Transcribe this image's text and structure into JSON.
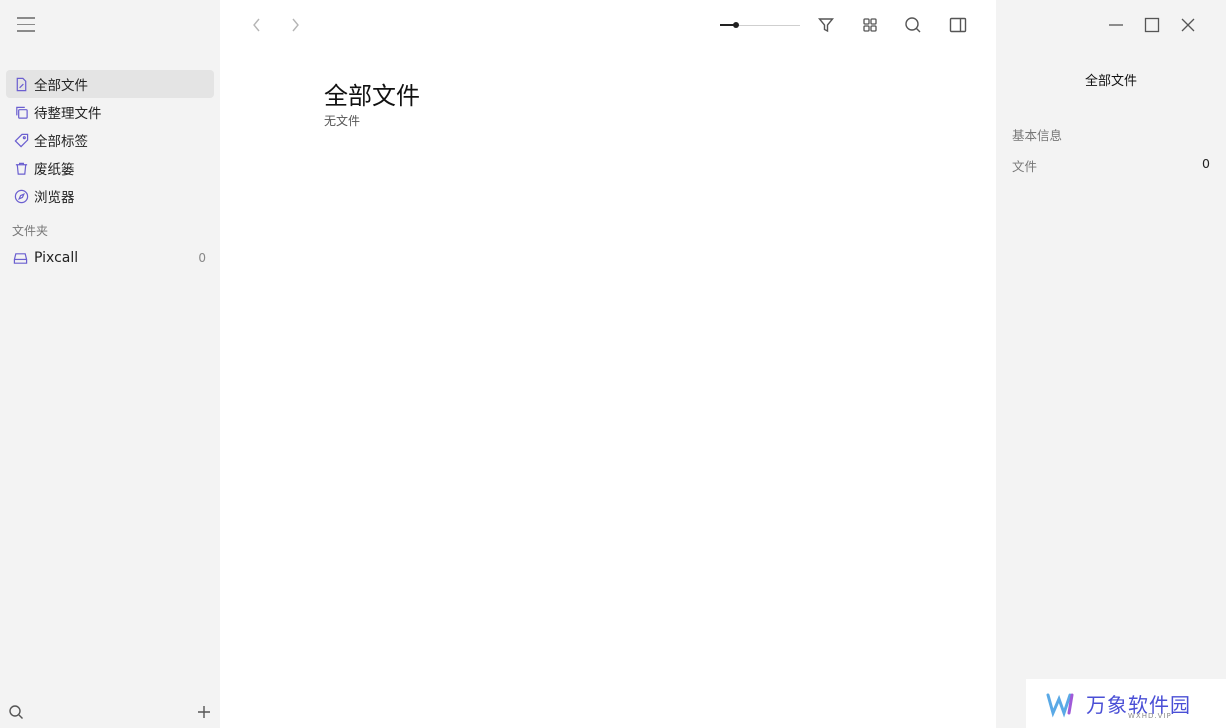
{
  "sidebar": {
    "items": [
      {
        "label": "全部文件",
        "icon": "file-icon",
        "active": true
      },
      {
        "label": "待整理文件",
        "icon": "copy-icon",
        "active": false
      },
      {
        "label": "全部标签",
        "icon": "tag-icon",
        "active": false
      },
      {
        "label": "废纸篓",
        "icon": "trash-icon",
        "active": false
      },
      {
        "label": "浏览器",
        "icon": "compass-icon",
        "active": false
      }
    ],
    "section_label": "文件夹",
    "folders": [
      {
        "label": "Pixcall",
        "count": "0",
        "icon": "drive-icon"
      }
    ]
  },
  "main": {
    "title": "全部文件",
    "subtitle": "无文件",
    "zoom_level": 0.2
  },
  "panel": {
    "title": "全部文件",
    "section": "基本信息",
    "rows": [
      {
        "label": "文件",
        "value": "0"
      }
    ]
  },
  "watermark": {
    "text": "万象软件园",
    "sub": "WXHD.VIP"
  },
  "colors": {
    "accent": "#6b5fd0",
    "sidebar_bg": "#f3f3f3",
    "active_bg": "#e4e4e4"
  }
}
